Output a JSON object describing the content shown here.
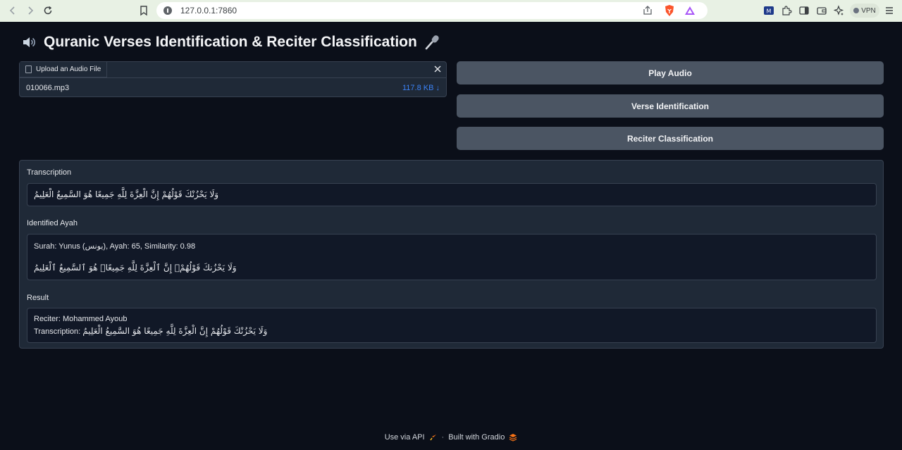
{
  "browser": {
    "url": "127.0.0.1:7860",
    "vpn_label": "VPN"
  },
  "app": {
    "title": "Quranic Verses Identification & Reciter Classification"
  },
  "upload": {
    "tab_label": "Upload an Audio File",
    "file_name": "010066.mp3",
    "file_size": "117.8 KB ↓"
  },
  "buttons": {
    "play": "Play Audio",
    "verse": "Verse Identification",
    "reciter": "Reciter Classification"
  },
  "transcription": {
    "label": "Transcription",
    "text": "وَلَا يَحْزُنْكَ قَوْلُهُمْ إِنَّ الْعِزَّةَ لِلَّهِ جَمِيعًا هُوَ السَّمِيعُ الْعَلِيمُ"
  },
  "ayah": {
    "label": "Identified Ayah",
    "info": "Surah: Yunus (يونس), Ayah: 65, Similarity: 0.98",
    "text": "وَلَا يَحْزُنكَ قَوْلُهُمْۘ إِنَّ ٱلْعِزَّةَ لِلَّهِ جَمِيعًاۚ هُوَ ٱلسَّمِيعُ ٱلْعَلِيمُ"
  },
  "result": {
    "label": "Result",
    "reciter_line": "Reciter: Mohammed Ayoub",
    "transcription_prefix": "Transcription: ",
    "transcription_text": "وَلَا يَحْزُنْكَ قَوْلُهُمْ إِنَّ الْعِزَّةَ لِلَّهِ جَمِيعًا هُوَ السَّمِيعُ الْعَلِيمُ"
  },
  "footer": {
    "api": "Use via API",
    "separator": "·",
    "built": "Built with Gradio"
  }
}
